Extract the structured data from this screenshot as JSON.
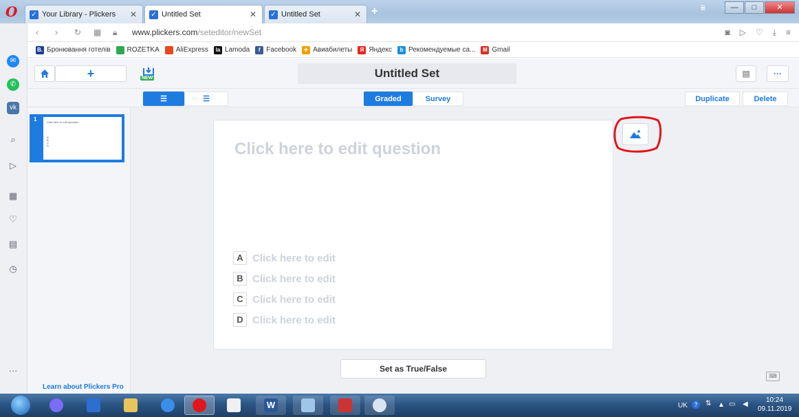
{
  "browser": {
    "tabs": [
      {
        "label": "Your Library - Plickers",
        "active": false
      },
      {
        "label": "Untitled Set",
        "active": true
      },
      {
        "label": "Untitled Set",
        "active": false
      }
    ],
    "url_host": "www.plickers.com",
    "url_path": "/seteditor/newSet",
    "bookmarks": [
      {
        "label": "Бронювання готелів",
        "icon": "booking-icon",
        "color": "#1b3d8f",
        "glyph": "B."
      },
      {
        "label": "ROZETKA",
        "icon": "rozetka-icon",
        "color": "#2fa84f",
        "glyph": ""
      },
      {
        "label": "AliExpress",
        "icon": "aliexpress-icon",
        "color": "#e8481c",
        "glyph": ""
      },
      {
        "label": "Lamoda",
        "icon": "lamoda-icon",
        "color": "#111111",
        "glyph": "la"
      },
      {
        "label": "Facebook",
        "icon": "facebook-icon",
        "color": "#3b5998",
        "glyph": "f"
      },
      {
        "label": "Авиабилеты",
        "icon": "plane-icon",
        "color": "#f0a000",
        "glyph": "✈"
      },
      {
        "label": "Яндекс",
        "icon": "yandex-icon",
        "color": "#e52620",
        "glyph": "Я"
      },
      {
        "label": "Рекомендуемые са...",
        "icon": "recommended-icon",
        "color": "#1d8fe1",
        "glyph": "b"
      },
      {
        "label": "Gmail",
        "icon": "gmail-icon",
        "color": "#d93025",
        "glyph": "M"
      }
    ]
  },
  "app": {
    "new_badge": "NEW",
    "set_title": "Untitled Set",
    "graded_label": "Graded",
    "survey_label": "Survey",
    "duplicate_label": "Duplicate",
    "delete_label": "Delete",
    "more_label": "···",
    "thumb_number": "1",
    "thumb_text": "Click here to edit question",
    "question_placeholder": "Click here to edit question",
    "answers": [
      {
        "letter": "A",
        "text": "Click here to edit"
      },
      {
        "letter": "B",
        "text": "Click here to edit"
      },
      {
        "letter": "C",
        "text": "Click here to edit"
      },
      {
        "letter": "D",
        "text": "Click here to edit"
      }
    ],
    "true_false_label": "Set as True/False",
    "learn_pro_label": "Learn about Plickers Pro"
  },
  "taskbar": {
    "lang": "UK",
    "time": "10:24",
    "date": "09.11.2019"
  },
  "colors": {
    "accent": "#1e7be0",
    "highlight_circle": "#e0161b"
  }
}
